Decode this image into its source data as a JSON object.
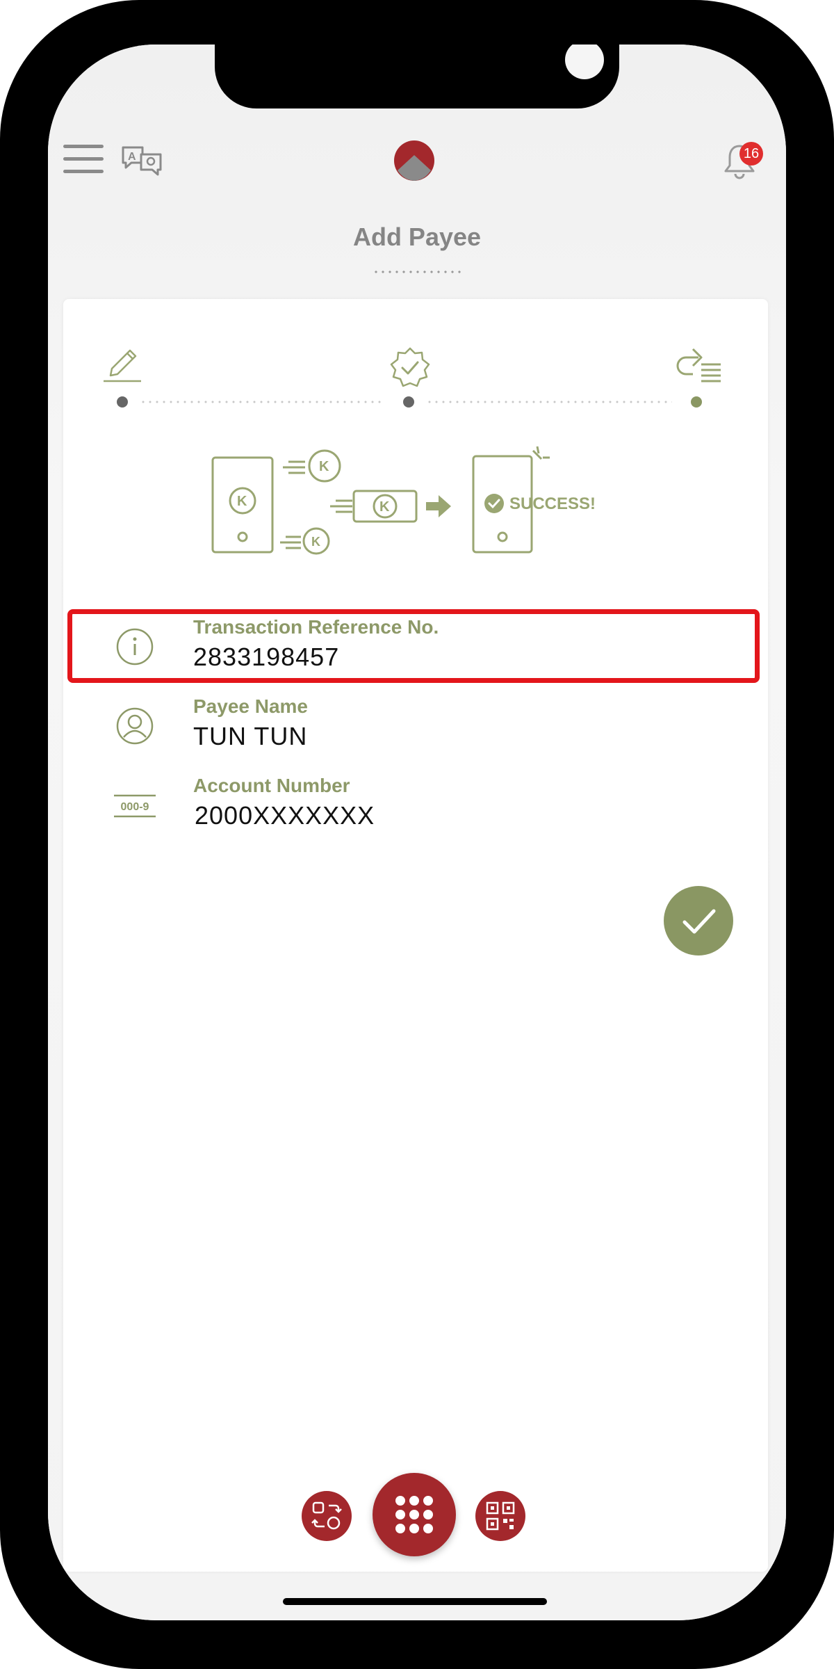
{
  "header": {
    "title": "Add Payee",
    "notification_count": "16"
  },
  "steps": [
    {
      "name": "edit",
      "icon": "pencil-icon"
    },
    {
      "name": "verify",
      "icon": "badge-check-icon"
    },
    {
      "name": "complete",
      "icon": "redo-list-icon"
    }
  ],
  "illustration": {
    "success_text": "SUCCESS!",
    "currency_symbol": "K"
  },
  "details": [
    {
      "label": "Transaction Reference No.",
      "value": "2833198457",
      "icon": "info-icon"
    },
    {
      "label": "Payee Name",
      "value": "TUN TUN",
      "icon": "user-circle-icon"
    },
    {
      "label": "Account Number",
      "value": "2000XXXXXXX",
      "icon": "account-number-icon",
      "icon_text": "000-9"
    }
  ],
  "colors": {
    "brand_red": "#a3282c",
    "accent_green": "#8a9763",
    "highlight": "#e3161b"
  },
  "bottom_bar": [
    {
      "name": "transfer",
      "icon": "transfer-icon"
    },
    {
      "name": "menu",
      "icon": "grid-icon"
    },
    {
      "name": "qr",
      "icon": "qr-code-icon"
    }
  ]
}
